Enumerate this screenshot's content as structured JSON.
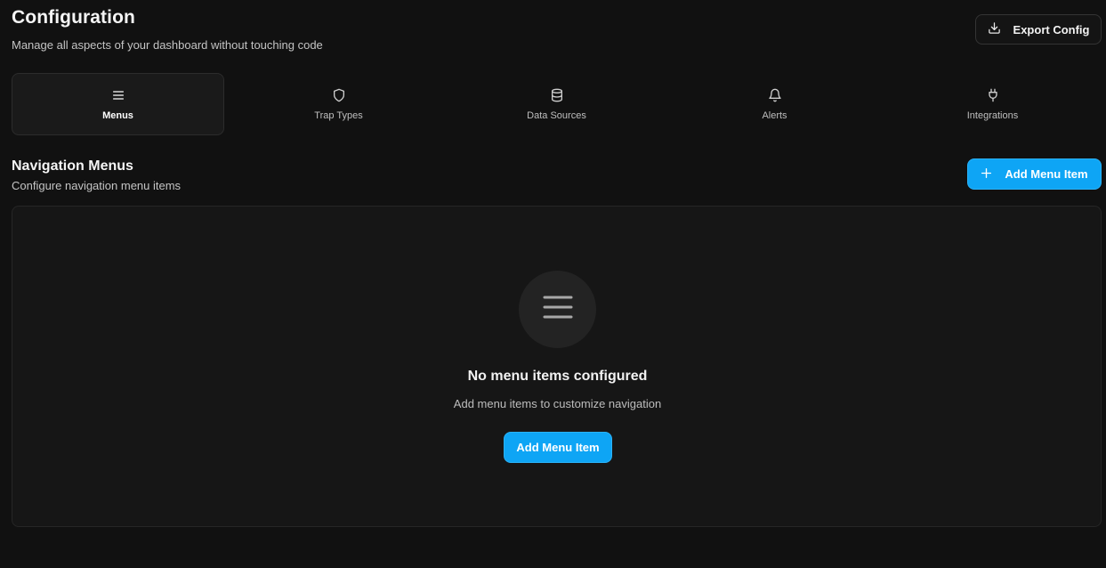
{
  "header": {
    "title": "Configuration",
    "subtitle": "Manage all aspects of your dashboard without touching code",
    "export_label": "Export Config",
    "export_icon": "download-icon"
  },
  "tabs": [
    {
      "label": "Menus",
      "icon": "menu-icon",
      "active": true
    },
    {
      "label": "Trap Types",
      "icon": "shield-icon",
      "active": false
    },
    {
      "label": "Data Sources",
      "icon": "database-icon",
      "active": false
    },
    {
      "label": "Alerts",
      "icon": "bell-icon",
      "active": false
    },
    {
      "label": "Integrations",
      "icon": "plug-icon",
      "active": false
    }
  ],
  "section": {
    "title": "Navigation Menus",
    "subtitle": "Configure navigation menu items",
    "add_label": "Add Menu Item"
  },
  "empty_state": {
    "icon": "menu-icon",
    "title": "No menu items configured",
    "description": "Add menu items to customize navigation",
    "button_label": "Add Menu Item"
  },
  "colors": {
    "background": "#111111",
    "accent": "#0ea5f5",
    "panel": "#161616"
  }
}
